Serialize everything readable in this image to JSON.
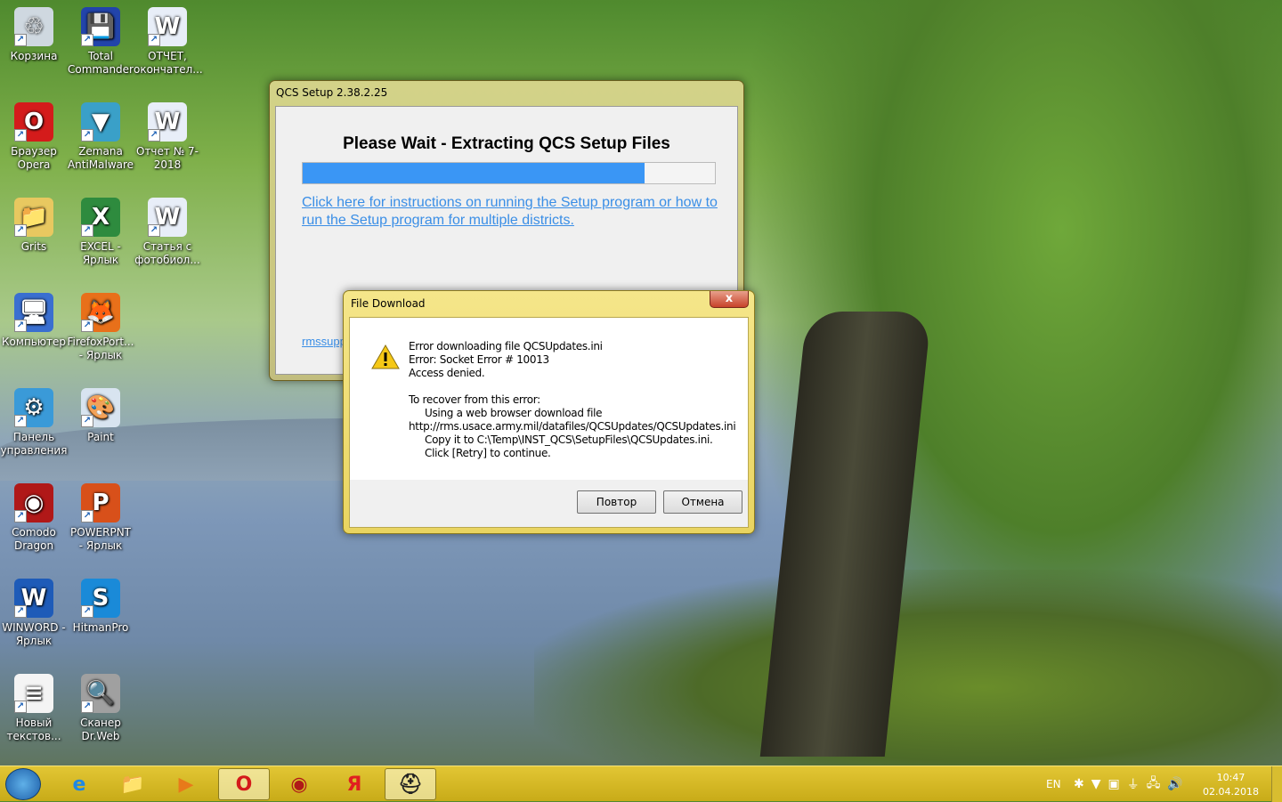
{
  "desktop": {
    "icons": [
      {
        "label": "Корзина",
        "icon": "recycle-bin-icon",
        "glyph": "♲",
        "color": "#cfd8e0"
      },
      {
        "label": "Total Commander",
        "icon": "floppy-icon",
        "glyph": "💾",
        "color": "#2244aa"
      },
      {
        "label": "ОТЧЕТ, окончател...",
        "icon": "word-doc-icon",
        "glyph": "W",
        "color": "#e8eef8"
      },
      {
        "label": "Браузер Opera",
        "icon": "opera-icon",
        "glyph": "O",
        "color": "#d41b1b"
      },
      {
        "label": "Zemana AntiMalware",
        "icon": "zemana-icon",
        "glyph": "▼",
        "color": "#3aa0c8"
      },
      {
        "label": "Отчет № 7-2018",
        "icon": "word-doc-icon",
        "glyph": "W",
        "color": "#e8eef8"
      },
      {
        "label": "Grits",
        "icon": "user-folder-icon",
        "glyph": "📁",
        "color": "#e8c860"
      },
      {
        "label": "EXCEL - Ярлык",
        "icon": "excel-icon",
        "glyph": "X",
        "color": "#2e8b3e"
      },
      {
        "label": "Статья с фотобиол...",
        "icon": "word-doc-icon",
        "glyph": "W",
        "color": "#e8eef8"
      },
      {
        "label": "Компьютер",
        "icon": "computer-icon",
        "glyph": "🖥",
        "color": "#3a6fd0"
      },
      {
        "label": "FirefoxPort... - Ярлык",
        "icon": "firefox-icon",
        "glyph": "🦊",
        "color": "#e8701a"
      },
      {
        "label": "Панель управления",
        "icon": "control-panel-icon",
        "glyph": "⚙",
        "color": "#3a9ad8"
      },
      {
        "label": "Paint",
        "icon": "paint-icon",
        "glyph": "🎨",
        "color": "#d8e4f0"
      },
      {
        "label": "Comodo Dragon",
        "icon": "comodo-dragon-icon",
        "glyph": "◉",
        "color": "#b01818"
      },
      {
        "label": "POWERPNT - Ярлык",
        "icon": "powerpoint-icon",
        "glyph": "P",
        "color": "#d8501a"
      },
      {
        "label": "WINWORD - Ярлык",
        "icon": "word-icon",
        "glyph": "W",
        "color": "#1e5bb8"
      },
      {
        "label": "HitmanPro",
        "icon": "hitmanpro-icon",
        "glyph": "S",
        "color": "#1a8ad8"
      },
      {
        "label": "Новый текстов...",
        "icon": "text-file-icon",
        "glyph": "≡",
        "color": "#f4f4f4"
      },
      {
        "label": "Сканер Dr.Web",
        "icon": "drweb-icon",
        "glyph": "🔍",
        "color": "#a0a0a0"
      }
    ]
  },
  "qcs": {
    "title": "QCS Setup  2.38.2.25",
    "heading": "Please Wait - Extracting QCS Setup Files",
    "progress_percent": 83,
    "progress_color": "#3a96f5",
    "instructions_link": "Click here for instructions on running the Setup program or how to run the Setup program for multiple districts.",
    "support_link": "rmssupp"
  },
  "file_download": {
    "title": "File Download",
    "close_label": "x",
    "lines": [
      "Error downloading file QCSUpdates.ini",
      "Error: Socket Error # 10013",
      "Access denied.",
      "",
      "To recover from this error:"
    ],
    "steps": {
      "s1": "Using a web browser download file",
      "url": "http://rms.usace.army.mil/datafiles/QCSUpdates/QCSUpdates.ini",
      "s2": "Copy it to C:\\Temp\\INST_QCS\\SetupFiles\\QCSUpdates.ini.",
      "s3": "Click [Retry] to continue."
    },
    "retry_label": "Повтор",
    "cancel_label": "Отмена"
  },
  "taskbar": {
    "items": [
      {
        "name": "internet-explorer",
        "glyph": "e",
        "color": "#1e88e5"
      },
      {
        "name": "file-explorer",
        "glyph": "📁",
        "color": "#e8c860"
      },
      {
        "name": "media-player",
        "glyph": "▶",
        "color": "#e87a1a"
      },
      {
        "name": "opera",
        "glyph": "O",
        "color": "#d41b1b"
      },
      {
        "name": "comodo-dragon",
        "glyph": "◉",
        "color": "#b01818"
      },
      {
        "name": "yandex",
        "glyph": "Я",
        "color": "#e02020"
      },
      {
        "name": "qcs-setup",
        "glyph": "⛑",
        "color": "#222"
      }
    ],
    "lang": "EN",
    "time": "10:47",
    "date": "02.04.2018"
  }
}
